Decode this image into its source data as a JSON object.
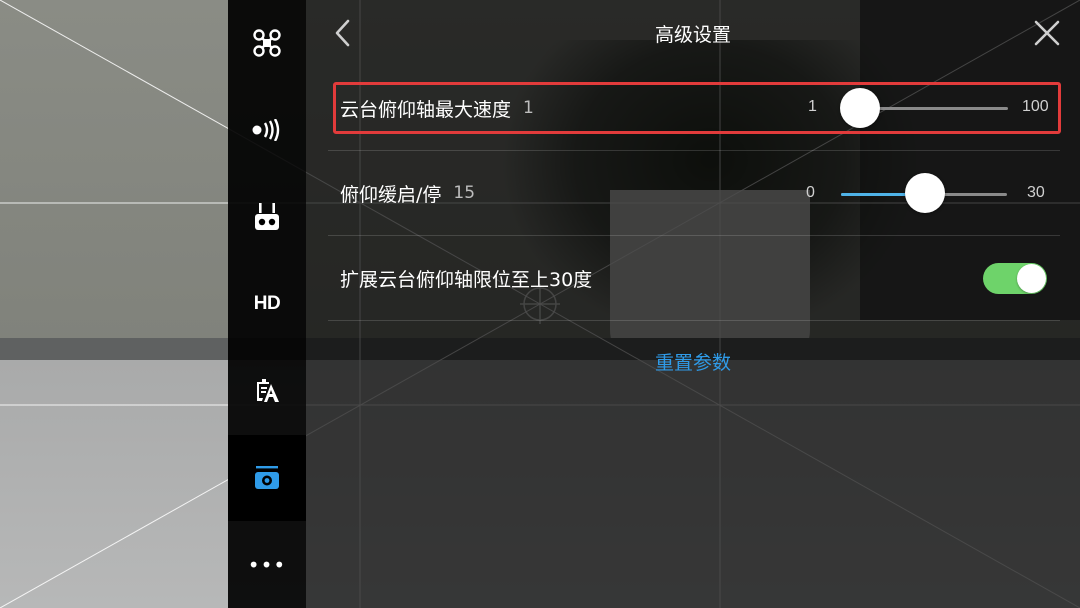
{
  "header": {
    "title": "高级设置",
    "back_icon": "chevron-left-icon",
    "close_icon": "close-icon"
  },
  "sidebar": {
    "items": [
      {
        "name": "aircraft",
        "icon": "drone-icon",
        "active": false
      },
      {
        "name": "signal",
        "icon": "signal-icon",
        "active": false
      },
      {
        "name": "remote-controller",
        "icon": "remote-controller-icon",
        "active": false
      },
      {
        "name": "hd",
        "label": "HD",
        "active": false
      },
      {
        "name": "battery",
        "icon": "battery-icon",
        "active": false
      },
      {
        "name": "gimbal",
        "icon": "gimbal-icon",
        "active": true
      },
      {
        "name": "more",
        "label": "•••",
        "active": false
      }
    ]
  },
  "settings": {
    "pitch_max_speed": {
      "label": "云台俯仰轴最大速度",
      "value": "1",
      "min": "1",
      "max": "100",
      "current": 1
    },
    "pitch_smoothing": {
      "label": "俯仰缓启/停",
      "value": "15",
      "min": "0",
      "max": "30",
      "current": 15
    },
    "extend_pitch_limit": {
      "label": "扩展云台俯仰轴限位至上30度",
      "enabled": true
    }
  },
  "reset_label": "重置参数",
  "colors": {
    "accent_blue": "#2f9be8",
    "slider_fill": "#4fb3e8",
    "toggle_on": "#6ed36a",
    "highlight_red": "#e23b3b"
  }
}
